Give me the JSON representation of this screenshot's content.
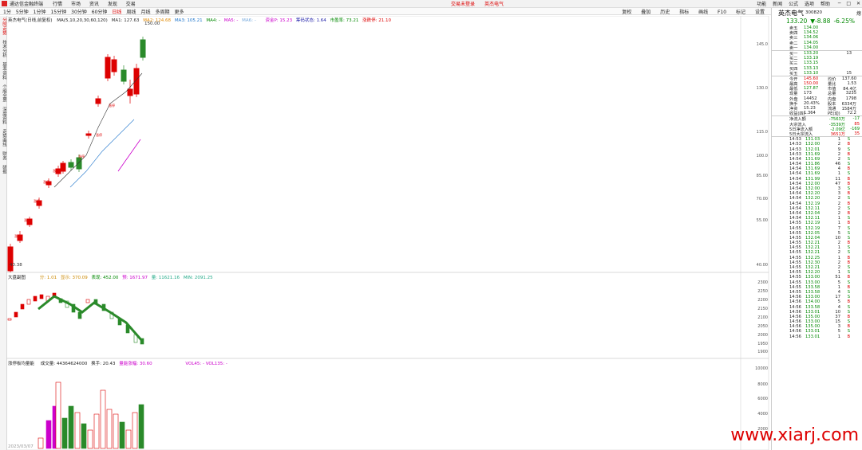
{
  "titlebar": {
    "app_title": "通达信金融终端",
    "menus": [
      "行情",
      "市场",
      "资讯",
      "发现",
      "交易"
    ],
    "center_tabs": [
      "交易未登录",
      "英杰电气"
    ],
    "right_menus": [
      "功能",
      "新闻",
      "公式",
      "选项",
      "帮助"
    ],
    "window_controls": [
      "─",
      "□",
      "✕"
    ]
  },
  "toolbar": {
    "periods": [
      "1分",
      "5分钟",
      "1分钟",
      "15分钟",
      "30分钟",
      "60分钟",
      "日线",
      "周线",
      "月线",
      "多周期",
      "更多"
    ],
    "active_period": "日线",
    "right_buttons": [
      "复权",
      "叠加",
      "历史",
      "指标",
      "画线",
      "F10",
      "标记",
      "设置"
    ]
  },
  "sidebar": {
    "items": [
      "分时走势",
      "技术分析",
      "基本资料",
      "个股全景",
      "深度资料",
      "走势曲线",
      "财务",
      "研报"
    ]
  },
  "kline": {
    "legend_name": "英杰电气(日线,前复权)",
    "ma_legend": [
      "MA(5,10,20,30,60,120)",
      "MA1: 127.63",
      "MA2: 124.68",
      "MA3: 105.21",
      "MA4: -",
      "MA5: -",
      "MA6: -"
    ],
    "extra_legend": [
      "资金P: 15.23",
      "筹码状态: 1.64",
      "市盈率: 73.21",
      "涨跌停: 21.10"
    ],
    "high_label": "150.00",
    "low_label": "40.38",
    "ylabels": [
      "145.0",
      "130.0",
      "115.0",
      "100.0",
      "85.00",
      "70.00",
      "55.00",
      "40.00"
    ],
    "ylim": [
      38,
      152
    ]
  },
  "index_panel": {
    "legend_name": "大盘副图",
    "legend_values": [
      "分: 1.01",
      "显示: 370.09",
      "表现: 452.00",
      "预: 1671.97",
      "量: 11621.16",
      "MIN: 2091.25"
    ],
    "ylabels": [
      "2300",
      "2250",
      "2200",
      "2150",
      "2100",
      "2050",
      "2000",
      "1950",
      "1900"
    ]
  },
  "volume_panel": {
    "legend_name": "涨停板均量能",
    "legend_values": [
      "成交量: 44364624000",
      "换手: 20.43",
      "量能涨幅: 30.60"
    ],
    "vol_legend": "VOL45: -  VOL135: -",
    "ylabels": [
      "10000",
      "8000",
      "6000",
      "4000",
      "2000"
    ]
  },
  "quote": {
    "name": "英杰电气",
    "code": "300820",
    "badge": "熄",
    "price": "133.20",
    "change": "▼-8.88",
    "change_pct": "-6.25%",
    "asks": [
      [
        "卖五",
        "134.00",
        ""
      ],
      [
        "卖四",
        "134.52",
        ""
      ],
      [
        "卖三",
        "134.06",
        ""
      ],
      [
        "卖二",
        "134.05",
        ""
      ],
      [
        "卖一",
        "134.00",
        ""
      ]
    ],
    "bids": [
      [
        "买一",
        "133.20",
        "13"
      ],
      [
        "买二",
        "133.19",
        ""
      ],
      [
        "买三",
        "133.15",
        ""
      ],
      [
        "买四",
        "133.13",
        ""
      ],
      [
        "买五",
        "133.10",
        "15"
      ]
    ],
    "stats": [
      [
        "今开",
        "145.60",
        "均价",
        "137.60"
      ],
      [
        "最高",
        "150.00",
        "量比",
        "1.53"
      ],
      [
        "最低",
        "127.87",
        "市值",
        "84.4亿"
      ],
      [
        "现量",
        "173",
        "总量",
        "3235"
      ],
      [
        "外盘",
        "14452",
        "内盘",
        "1798"
      ],
      [
        "换手",
        "20.43%",
        "股本",
        "6334万"
      ],
      [
        "净资",
        "15.23",
        "流通",
        "1584万"
      ],
      [
        "收益(四)",
        "1.364",
        "PE(动)",
        "72.2"
      ]
    ],
    "flows": [
      [
        "净流入额",
        "-7563万",
        "-17"
      ],
      [
        "大宗流入",
        "-3539万",
        "85"
      ],
      [
        "5日净流入额",
        "-2.09亿",
        "-169"
      ],
      [
        "5日大宗流入",
        "3651万",
        "35"
      ]
    ],
    "ticks": [
      [
        "14:53",
        "131.03",
        "1",
        "S"
      ],
      [
        "14:53",
        "132.00",
        "2",
        "B"
      ],
      [
        "14:53",
        "132.01",
        "9",
        "S"
      ],
      [
        "14:53",
        "131.69",
        "2",
        "B"
      ],
      [
        "14:54",
        "131.69",
        "2",
        "S"
      ],
      [
        "14:54",
        "131.86",
        "46",
        "S"
      ],
      [
        "14:54",
        "131.69",
        "4",
        "B"
      ],
      [
        "14:54",
        "131.69",
        "1",
        "S"
      ],
      [
        "14:54",
        "131.99",
        "11",
        "B"
      ],
      [
        "14:54",
        "132.00",
        "47",
        "B"
      ],
      [
        "14:54",
        "132.00",
        "3",
        "S"
      ],
      [
        "14:54",
        "132.20",
        "3",
        "B"
      ],
      [
        "14:54",
        "132.20",
        "2",
        "S"
      ],
      [
        "14:54",
        "132.19",
        "2",
        "B"
      ],
      [
        "14:54",
        "132.11",
        "2",
        "S"
      ],
      [
        "14:54",
        "132.04",
        "2",
        "B"
      ],
      [
        "14:54",
        "132.11",
        "1",
        "S"
      ],
      [
        "14:55",
        "132.19",
        "1",
        "B"
      ],
      [
        "14:55",
        "132.19",
        "7",
        "S"
      ],
      [
        "14:55",
        "132.05",
        "5",
        "S"
      ],
      [
        "14:55",
        "132.04",
        "10",
        "S"
      ],
      [
        "14:55",
        "132.21",
        "2",
        "B"
      ],
      [
        "14:55",
        "132.21",
        "1",
        "S"
      ],
      [
        "14:55",
        "132.21",
        "2",
        "S"
      ],
      [
        "14:55",
        "132.25",
        "1",
        "B"
      ],
      [
        "14:55",
        "132.30",
        "2",
        "B"
      ],
      [
        "14:55",
        "132.21",
        "2",
        "S"
      ],
      [
        "14:55",
        "132.20",
        "1",
        "S"
      ],
      [
        "14:55",
        "133.00",
        "51",
        "B"
      ],
      [
        "14:55",
        "133.00",
        "5",
        "S"
      ],
      [
        "14:55",
        "133.58",
        "1",
        "B"
      ],
      [
        "14:55",
        "133.58",
        "4",
        "S"
      ],
      [
        "14:56",
        "133.00",
        "17",
        "S"
      ],
      [
        "14:56",
        "134.00",
        "5",
        "B"
      ],
      [
        "14:56",
        "133.58",
        "4",
        "S"
      ],
      [
        "14:56",
        "133.01",
        "10",
        "S"
      ],
      [
        "14:56",
        "135.00",
        "37",
        "B"
      ],
      [
        "14:56",
        "133.00",
        "15",
        "S"
      ],
      [
        "14:56",
        "135.00",
        "3",
        "B"
      ],
      [
        "14:56",
        "133.01",
        "5",
        "S"
      ],
      [
        "14:56",
        "133.01",
        "1",
        "B"
      ]
    ]
  },
  "watermark": "www.xiarj.com",
  "status_date": "2023/03/07"
}
